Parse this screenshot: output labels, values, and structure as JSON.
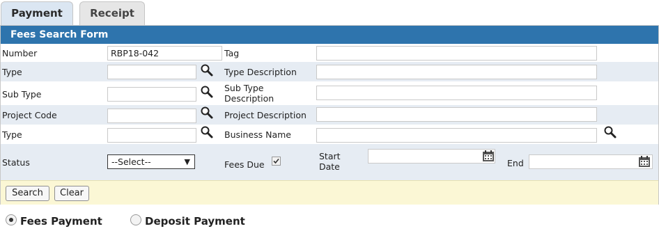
{
  "tabs": [
    {
      "label": "Payment",
      "active": true
    },
    {
      "label": "Receipt",
      "active": false
    }
  ],
  "form": {
    "title": "Fees Search Form",
    "fields": {
      "number": {
        "label": "Number",
        "value": "RBP18-042"
      },
      "tag": {
        "label": "Tag",
        "value": ""
      },
      "type1": {
        "label": "Type",
        "value": ""
      },
      "type_description": {
        "label": "Type Description",
        "value": ""
      },
      "sub_type": {
        "label": "Sub Type",
        "value": ""
      },
      "sub_type_description": {
        "label": "Sub Type Description",
        "value": ""
      },
      "project_code": {
        "label": "Project Code",
        "value": ""
      },
      "project_description": {
        "label": "Project Description",
        "value": ""
      },
      "type2": {
        "label": "Type",
        "value": ""
      },
      "business_name": {
        "label": "Business Name",
        "value": ""
      },
      "status": {
        "label": "Status",
        "selected": "--Select--"
      },
      "fees_due": {
        "label": "Fees Due",
        "checked": true
      },
      "start_date": {
        "label": "Start Date",
        "value": ""
      },
      "end_date": {
        "label": "End",
        "value": ""
      }
    },
    "buttons": {
      "search": "Search",
      "clear": "Clear"
    }
  },
  "payment_type": {
    "options": [
      {
        "label": "Fees Payment",
        "checked": true
      },
      {
        "label": "Deposit Payment",
        "checked": false
      }
    ]
  },
  "icons": {
    "lookup": "magnifier-icon",
    "calendar": "calendar-icon",
    "dropdown": "chevron-down-icon",
    "check": "checkmark-icon"
  },
  "colors": {
    "header": "#2e74ad",
    "row_alt": "#e6ecf3",
    "button_bar": "#fbf7d5",
    "active_tab": "#dbe6f2"
  }
}
